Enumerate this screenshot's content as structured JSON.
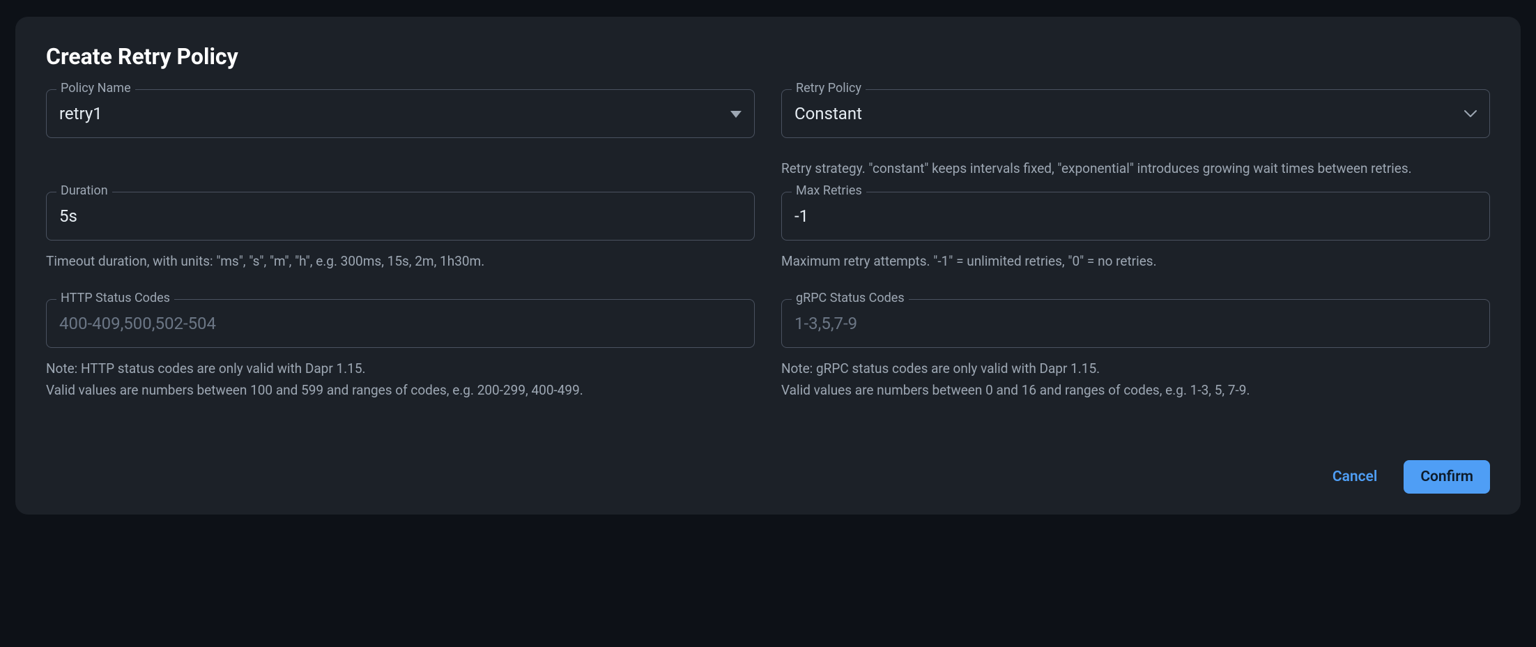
{
  "dialog": {
    "title": "Create Retry Policy",
    "policyName": {
      "label": "Policy Name",
      "value": "retry1"
    },
    "retryPolicy": {
      "label": "Retry Policy",
      "value": "Constant",
      "helper": "Retry strategy. \"constant\" keeps intervals fixed, \"exponential\" introduces growing wait times between retries."
    },
    "duration": {
      "label": "Duration",
      "value": "5s",
      "helper": "Timeout duration, with units: \"ms\", \"s\", \"m\", \"h\", e.g. 300ms, 15s, 2m, 1h30m."
    },
    "maxRetries": {
      "label": "Max Retries",
      "value": "-1",
      "helper": "Maximum retry attempts. \"-1\" = unlimited retries, \"0\" = no retries."
    },
    "httpCodes": {
      "label": "HTTP Status Codes",
      "placeholder": "400-409,500,502-504",
      "note1": "Note: HTTP status codes are only valid with Dapr 1.15.",
      "note2": "Valid values are numbers between 100 and 599 and ranges of codes, e.g. 200-299, 400-499."
    },
    "grpcCodes": {
      "label": "gRPC Status Codes",
      "placeholder": "1-3,5,7-9",
      "note1": "Note: gRPC status codes are only valid with Dapr 1.15.",
      "note2": "Valid values are numbers between 0 and 16 and ranges of codes, e.g. 1-3, 5, 7-9."
    },
    "actions": {
      "cancel": "Cancel",
      "confirm": "Confirm"
    }
  }
}
